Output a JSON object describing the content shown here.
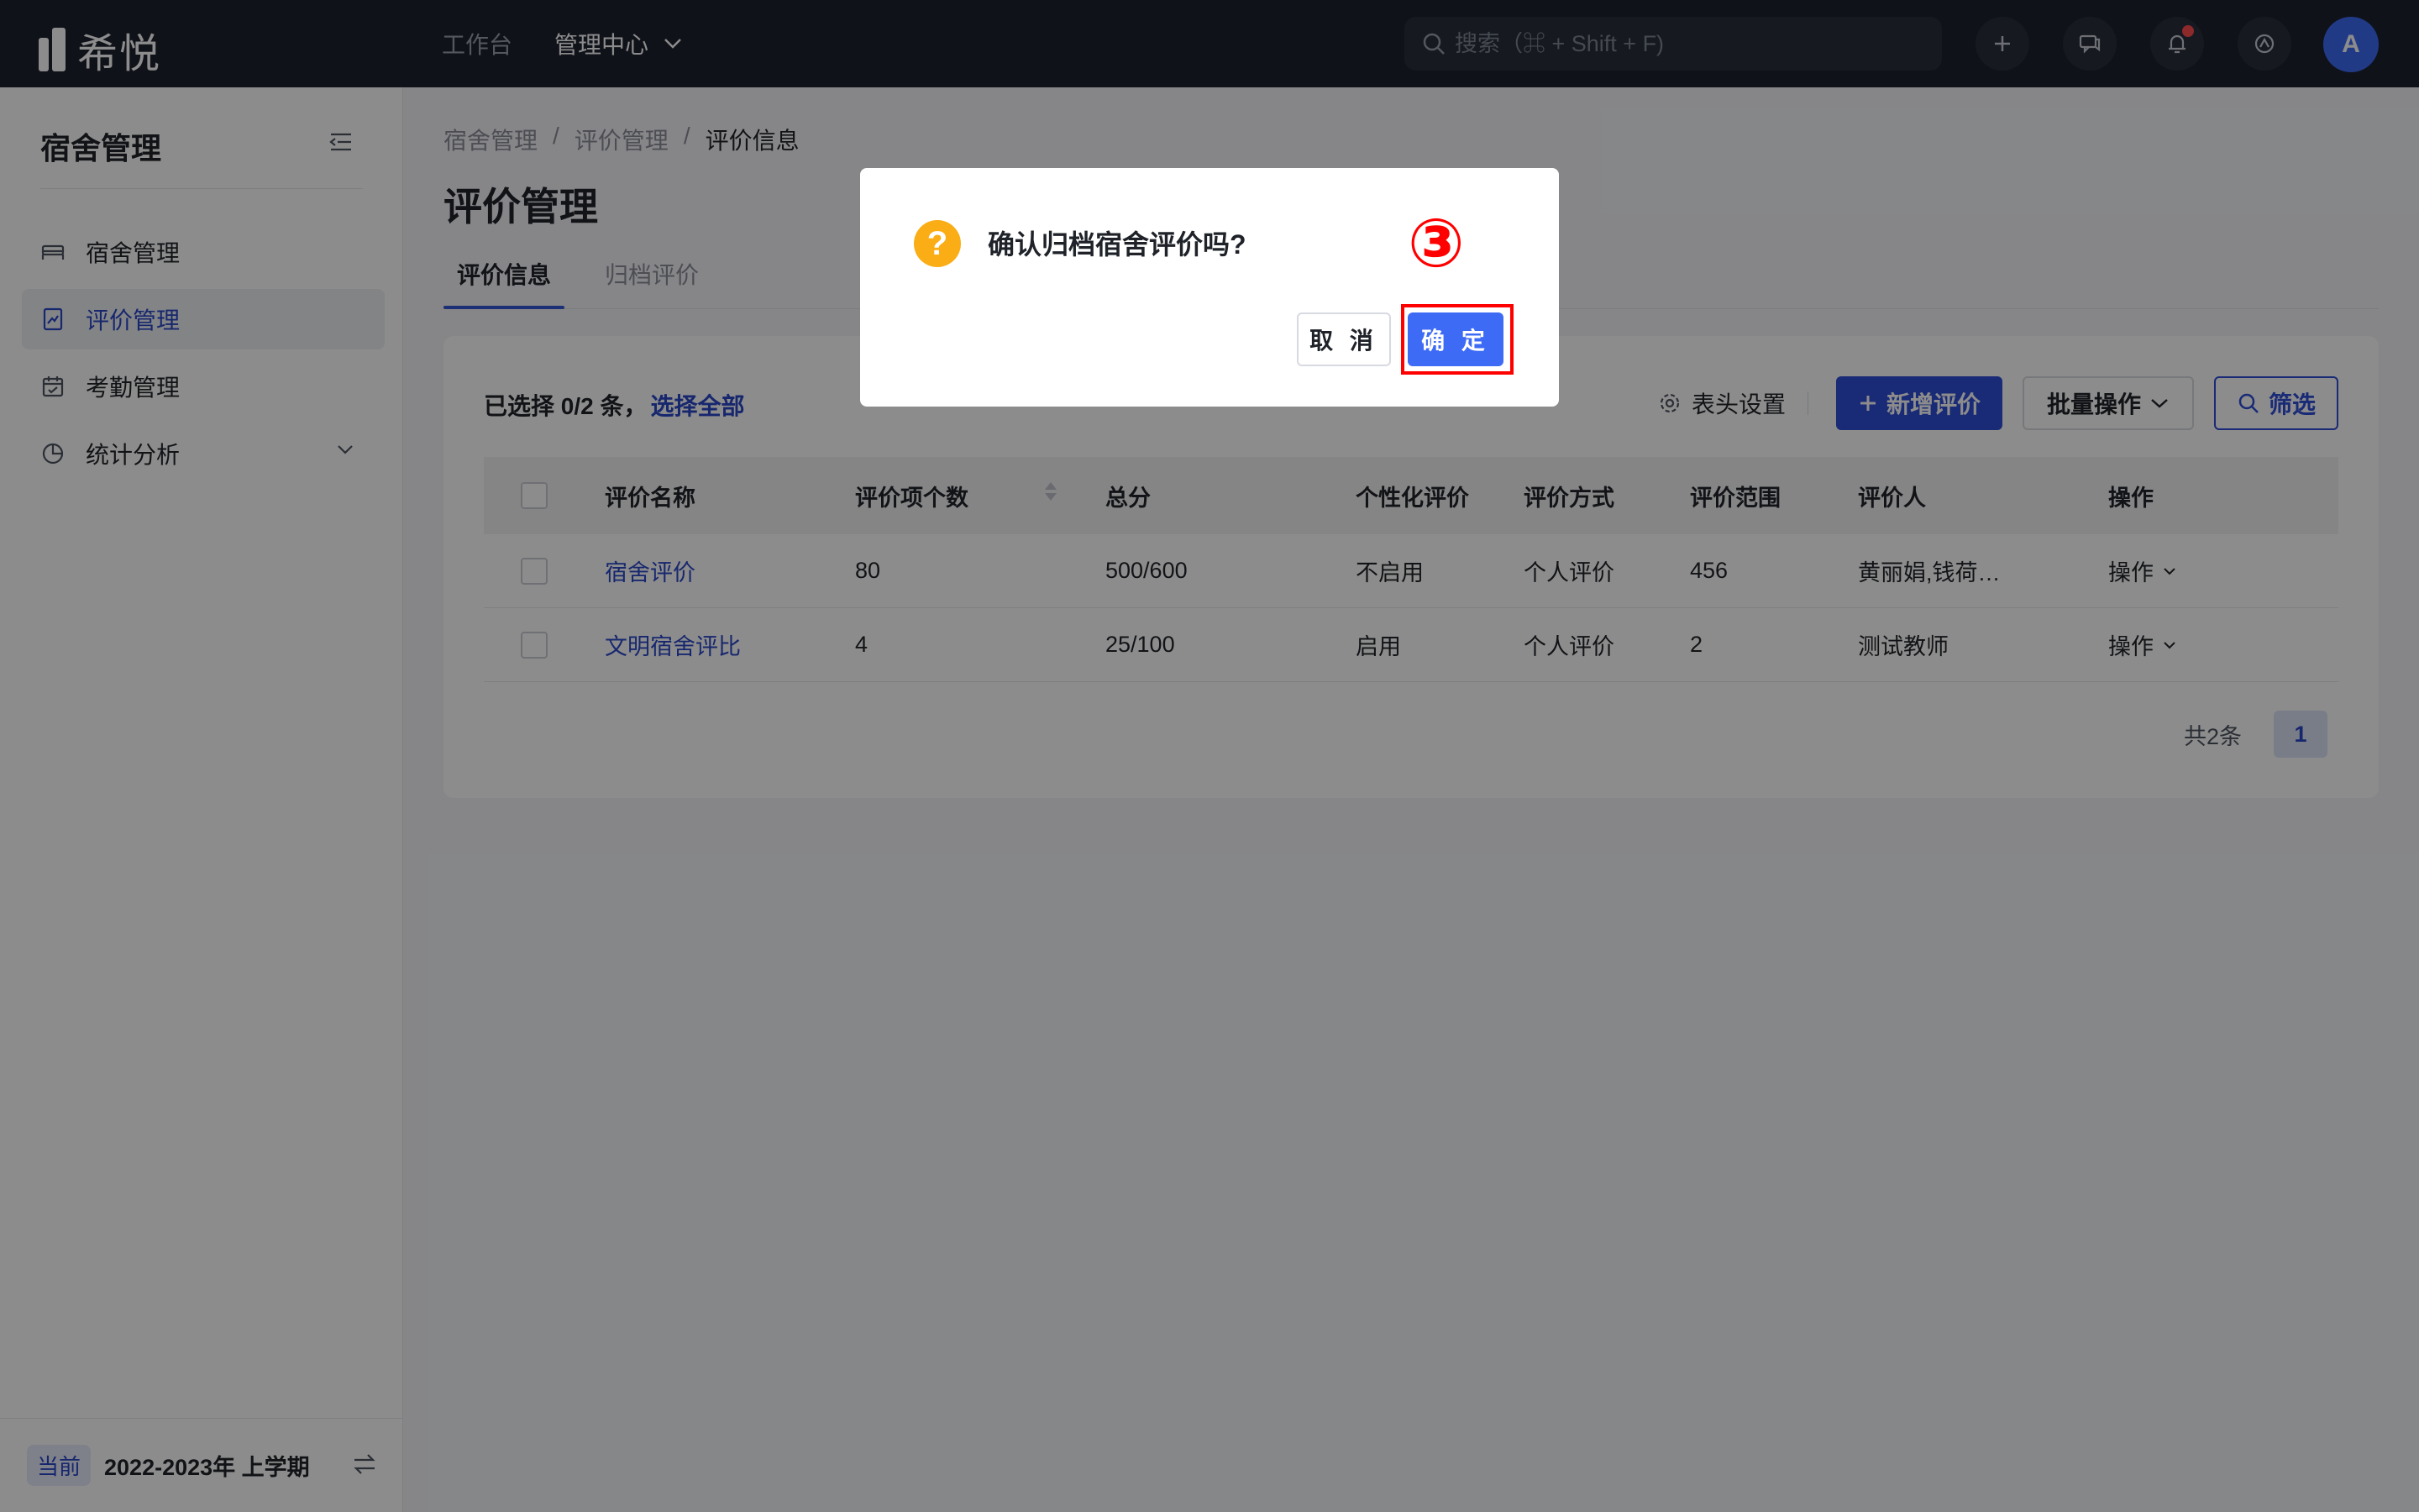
{
  "app": {
    "logo_text": "希悦"
  },
  "topnav": {
    "workbench": "工作台",
    "admin_center": "管理中心"
  },
  "search": {
    "placeholder": "搜索（⌘ + Shift + F)"
  },
  "user": {
    "avatar_initial": "A"
  },
  "sidebar": {
    "title": "宿舍管理",
    "items": [
      {
        "label": "宿舍管理",
        "icon": "bed-icon"
      },
      {
        "label": "评价管理",
        "icon": "evaluation-doc-icon",
        "active": true
      },
      {
        "label": "考勤管理",
        "icon": "calendar-check-icon"
      },
      {
        "label": "统计分析",
        "icon": "pie-chart-icon",
        "expandable": true
      }
    ],
    "footer": {
      "tag": "当前",
      "term": "2022-2023年 上学期"
    }
  },
  "breadcrumb": [
    "宿舍管理",
    "/",
    "评价管理",
    "/",
    "评价信息"
  ],
  "page": {
    "title": "评价管理",
    "tabs": [
      {
        "label": "评价信息",
        "active": true
      },
      {
        "label": "归档评价"
      }
    ]
  },
  "toolbar": {
    "selection_text": "已选择 0/2 条，",
    "select_all": "选择全部",
    "column_settings": "表头设置",
    "add_button": "新增评价",
    "batch_button": "批量操作",
    "filter_button": "筛选"
  },
  "table": {
    "headers": [
      "评价名称",
      "评价项个数",
      "总分",
      "个性化评价",
      "评价方式",
      "评价范围",
      "评价人",
      "操作"
    ],
    "rows": [
      [
        "宿舍评价",
        "80",
        "500/600",
        "不启用",
        "个人评价",
        "456",
        "黄丽娟,钱荷…",
        "操作"
      ],
      [
        "文明宿舍评比",
        "4",
        "25/100",
        "启用",
        "个人评价",
        "2",
        "测试教师",
        "操作"
      ]
    ]
  },
  "pagination": {
    "total": "共2条",
    "current_page": "1"
  },
  "modal": {
    "message": "确认归档宿舍评价吗?",
    "cancel": "取 消",
    "ok": "确 定",
    "step_marker": "③"
  },
  "colors": {
    "topbar": "#1e2230",
    "primary": "#2f4ed8",
    "link": "#2b47c9",
    "warning": "#faad14",
    "highlight": "#ff0000"
  }
}
